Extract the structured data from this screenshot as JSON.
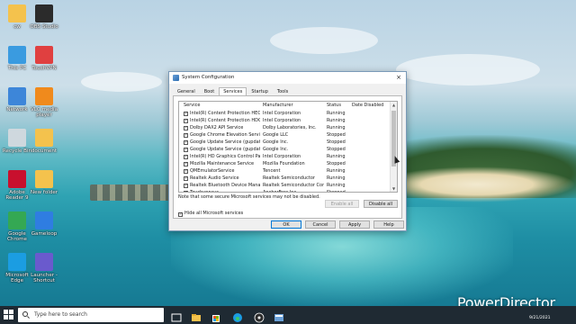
{
  "desktop": {
    "icons": [
      {
        "label": "cw",
        "color": "#f4c24d"
      },
      {
        "label": "OBS Studio",
        "color": "#2b2b2b"
      },
      {
        "label": "This PC",
        "color": "#3a9be0"
      },
      {
        "label": "TouchVPN",
        "color": "#e04040"
      },
      {
        "label": "Network",
        "color": "#3d86d9"
      },
      {
        "label": "VLC media player",
        "color": "#f08a1c"
      },
      {
        "label": "Recycle Bin",
        "color": "#cfd8de"
      },
      {
        "label": "document",
        "color": "#f4c24d"
      },
      {
        "label": "Adobe Reader 9",
        "color": "#c8102e"
      },
      {
        "label": "New folder",
        "color": "#f4c24d"
      },
      {
        "label": "Google Chrome",
        "color": "#34a853"
      },
      {
        "label": "Gameloop",
        "color": "#2f7de1"
      },
      {
        "label": "Microsoft Edge",
        "color": "#1b9de2"
      },
      {
        "label": "Launcher - Shortcut",
        "color": "#6a5acd"
      }
    ]
  },
  "dialog": {
    "title": "System Configuration",
    "close_label": "×",
    "tabs": [
      "General",
      "Boot",
      "Services",
      "Startup",
      "Tools"
    ],
    "active_tab": "Services",
    "columns": [
      "Service",
      "Manufacturer",
      "Status",
      "Date Disabled"
    ],
    "rows": [
      {
        "service": "Intel(R) Content Protection HEC...",
        "manufacturer": "Intel Corporation",
        "status": "Running",
        "checked": "✓"
      },
      {
        "service": "Intel(R) Content Protection HDC...",
        "manufacturer": "Intel Corporation",
        "status": "Running",
        "checked": "✓"
      },
      {
        "service": "Dolby DAX2 API Service",
        "manufacturer": "Dolby Laboratories, Inc.",
        "status": "Running",
        "checked": "✓"
      },
      {
        "service": "Google Chrome Elevation Servic...",
        "manufacturer": "Google LLC",
        "status": "Stopped",
        "checked": "✓"
      },
      {
        "service": "Google Update Service (gupdate)",
        "manufacturer": "Google Inc.",
        "status": "Stopped",
        "checked": "✓"
      },
      {
        "service": "Google Update Service (gupdatem)",
        "manufacturer": "Google Inc.",
        "status": "Stopped",
        "checked": "✓"
      },
      {
        "service": "Intel(R) HD Graphics Control Pa...",
        "manufacturer": "Intel Corporation",
        "status": "Running",
        "checked": "✓"
      },
      {
        "service": "Mozilla Maintenance Service",
        "manufacturer": "Mozilla Foundation",
        "status": "Stopped",
        "checked": "✓"
      },
      {
        "service": "QMEmulatorService",
        "manufacturer": "Tencent",
        "status": "Running",
        "checked": "✓"
      },
      {
        "service": "Realtek Audio Service",
        "manufacturer": "Realtek Semiconductor",
        "status": "Running",
        "checked": "✓"
      },
      {
        "service": "Realtek Bluetooth Device Manag...",
        "manufacturer": "Realtek Semiconductor Corp.",
        "status": "Running",
        "checked": "✓"
      },
      {
        "service": "Touchvpnsvc",
        "manufacturer": "AnchorFree Inc.",
        "status": "Stopped",
        "checked": "✓"
      }
    ],
    "scroll_up": "▲",
    "scroll_down": "▼",
    "note": "Note that some secure Microsoft services may not be disabled.",
    "enable_all": "Enable all",
    "disable_all": "Disable all",
    "hide_ms_label": "Hide all Microsoft services",
    "hide_ms_checked": "✓",
    "ok": "OK",
    "cancel": "Cancel",
    "apply": "Apply",
    "help": "Help"
  },
  "taskbar": {
    "search_placeholder": "Type here to search",
    "date": "9/21/2021"
  },
  "watermark": "PowerDirector"
}
